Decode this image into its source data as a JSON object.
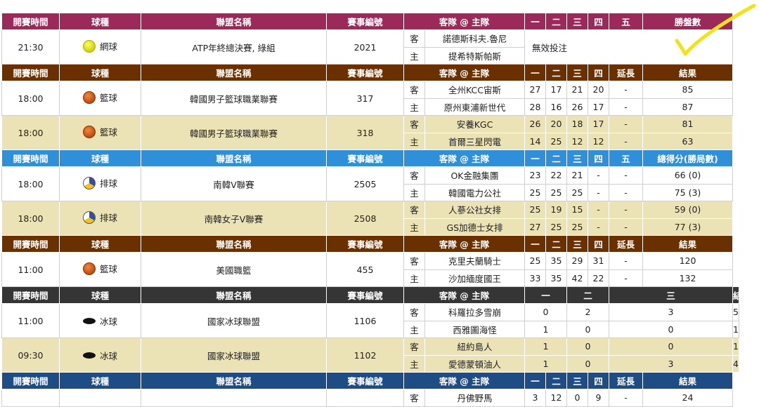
{
  "headers": {
    "tennis": [
      "開賽時間",
      "球種",
      "聯盟名稱",
      "賽事編號",
      "客隊 @ 主隊",
      "一",
      "二",
      "三",
      "四",
      "五",
      "勝盤數"
    ],
    "basketball": [
      "開賽時間",
      "球種",
      "聯盟名稱",
      "賽事編號",
      "客隊 @ 主隊",
      "一",
      "二",
      "三",
      "四",
      "延長",
      "結果"
    ],
    "volleyball": [
      "開賽時間",
      "球種",
      "聯盟名稱",
      "賽事編號",
      "客隊 @ 主隊",
      "一",
      "二",
      "三",
      "四",
      "五",
      "總得分(勝局數)"
    ],
    "hockey": [
      "開賽時間",
      "球種",
      "聯盟名稱",
      "賽事編號",
      "客隊 @ 主隊",
      "一",
      "二",
      "三",
      "結果"
    ]
  },
  "tennis_game": {
    "time": "21:30",
    "sport": "網球",
    "league": "ATP年終總決賽, 綠組",
    "id": "2021",
    "away_label": "客",
    "home_label": "主",
    "away": "諾德斯科夫.魯尼",
    "home": "提希特斯帕斯",
    "note": "無效投注"
  },
  "basketball_games": [
    {
      "time": "18:00",
      "sport": "籃球",
      "league": "韓國男子籃球職業聯賽",
      "id": "317",
      "away_label": "客",
      "home_label": "主",
      "away": "全州KCC宙斯",
      "home": "原州東浦新世代",
      "away_scores": [
        "27",
        "17",
        "21",
        "20",
        "-",
        "85"
      ],
      "home_scores": [
        "28",
        "16",
        "26",
        "17",
        "-",
        "87"
      ]
    },
    {
      "time": "18:00",
      "sport": "籃球",
      "league": "韓國男子籃球職業聯賽",
      "id": "318",
      "away_label": "客",
      "home_label": "主",
      "away": "安養KGC",
      "home": "首爾三星閃電",
      "away_scores": [
        "26",
        "20",
        "18",
        "17",
        "-",
        "81"
      ],
      "home_scores": [
        "14",
        "25",
        "12",
        "12",
        "-",
        "63"
      ]
    }
  ],
  "volleyball_games": [
    {
      "time": "18:00",
      "sport": "排球",
      "league": "南韓V聯賽",
      "id": "2505",
      "away_label": "客",
      "home_label": "主",
      "away": "OK金融集團",
      "home": "韓國電力公社",
      "away_scores": [
        "23",
        "22",
        "21",
        "-",
        "-",
        "66 (0)"
      ],
      "home_scores": [
        "25",
        "25",
        "25",
        "-",
        "-",
        "75 (3)"
      ]
    },
    {
      "time": "18:00",
      "sport": "排球",
      "league": "南韓女子V聯賽",
      "id": "2508",
      "away_label": "客",
      "home_label": "主",
      "away": "人蔘公社女排",
      "home": "GS加德士女排",
      "away_scores": [
        "25",
        "19",
        "15",
        "-",
        "-",
        "59 (0)"
      ],
      "home_scores": [
        "27",
        "25",
        "25",
        "-",
        "-",
        "77 (3)"
      ]
    }
  ],
  "nba_game": {
    "time": "11:00",
    "sport": "籃球",
    "league": "美國職籃",
    "id": "455",
    "away_label": "客",
    "home_label": "主",
    "away": "克里夫蘭騎士",
    "home": "沙加緬度國王",
    "away_scores": [
      "25",
      "35",
      "29",
      "31",
      "-",
      "120"
    ],
    "home_scores": [
      "33",
      "35",
      "42",
      "22",
      "-",
      "132"
    ]
  },
  "hockey_games": [
    {
      "time": "11:00",
      "sport": "冰球",
      "league": "國家冰球聯盟",
      "id": "1106",
      "away_label": "客",
      "home_label": "主",
      "away": "科羅拉多雪崩",
      "home": "西雅圖海怪",
      "away_scores": [
        "0",
        "2",
        "3",
        "5"
      ],
      "home_scores": [
        "1",
        "0",
        "0",
        "1"
      ]
    },
    {
      "time": "09:30",
      "sport": "冰球",
      "league": "國家冰球聯盟",
      "id": "1102",
      "away_label": "客",
      "home_label": "主",
      "away": "紐約島人",
      "home": "愛德蒙頓油人",
      "away_scores": [
        "1",
        "0",
        "0",
        "1"
      ],
      "home_scores": [
        "1",
        "0",
        "3",
        "4"
      ]
    }
  ],
  "last_partial": {
    "away_label": "客",
    "away": "丹佛野馬",
    "away_scores": [
      "3",
      "12",
      "0",
      "9",
      "-",
      "24"
    ]
  },
  "colors": {
    "purple": "#9b2a5b",
    "brown": "#6b3000",
    "blue": "#2f8fd8",
    "dark": "#353535",
    "navy": "#1e4d86",
    "alt_row": "#ebe2b6",
    "check": "#f2e21a"
  }
}
